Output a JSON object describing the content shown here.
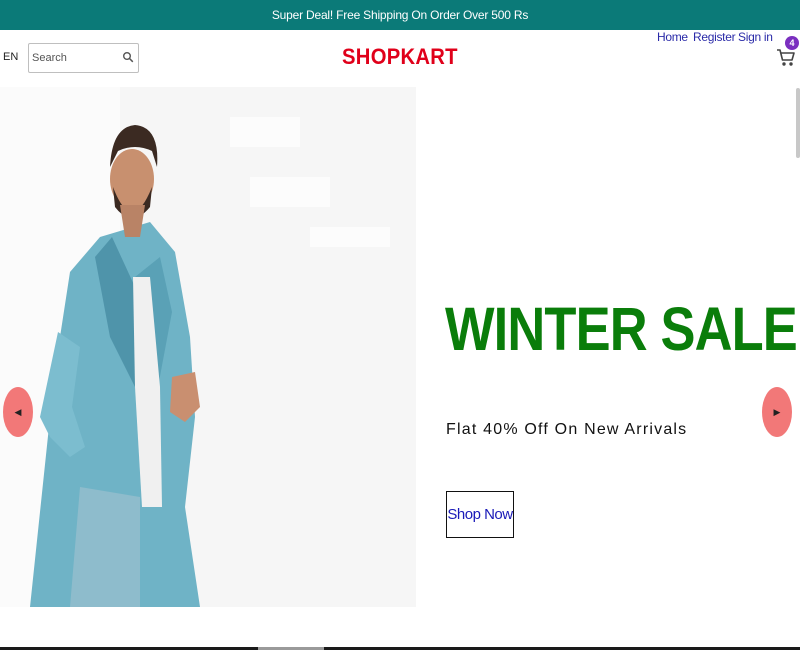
{
  "announcement": {
    "text": "Super Deal! Free Shipping On Order Over 500 Rs"
  },
  "navbar": {
    "language": "EN",
    "search": {
      "placeholder": "Search",
      "value": ""
    },
    "logo": "SHOPKART",
    "links": [
      "Home",
      "Register",
      "Sign in"
    ],
    "cart_count": "4"
  },
  "hero": {
    "title": "WINTER SALE",
    "subtitle": "Flat 40% Off On New Arrivals",
    "button_label": "Shop Now",
    "prev_arrow": "◀",
    "next_arrow": "▶"
  },
  "colors": {
    "announcement_bg": "#0b7a78",
    "logo": "#e0001a",
    "title": "#0a7d0a",
    "links": "#2a2aa8",
    "arrows": "#f27878",
    "badge": "#7b2fbf"
  },
  "icons": [
    "search-icon",
    "cart-icon",
    "arrow-left-icon",
    "arrow-right-icon"
  ]
}
